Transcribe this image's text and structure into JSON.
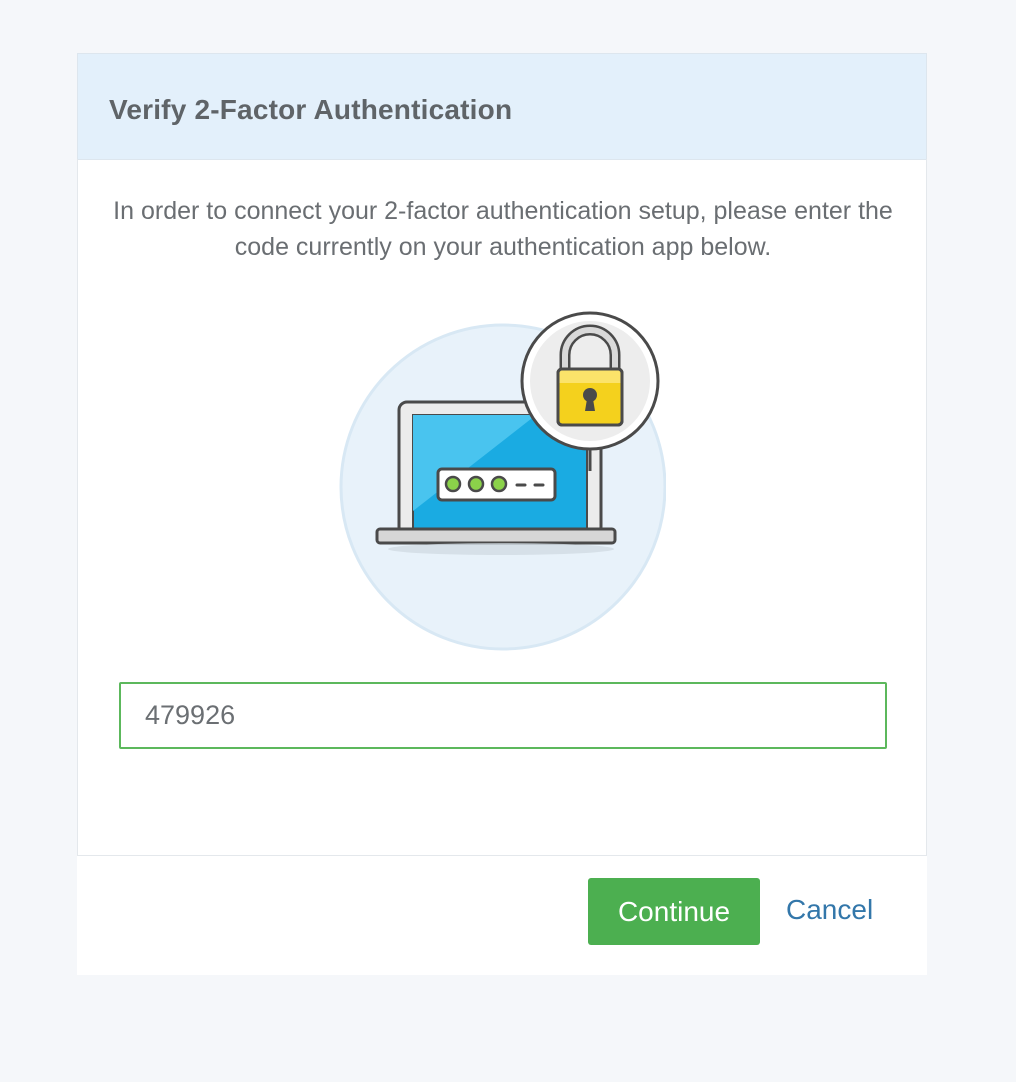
{
  "modal": {
    "title": "Verify 2-Factor Authentication",
    "intro": "In order to connect your 2-factor authentication setup, please enter the code currently on your authentication app below.",
    "illustration": {
      "icon": "laptop-lock-icon"
    },
    "code_input": {
      "value": "479926"
    },
    "buttons": {
      "continue": "Continue",
      "cancel": "Cancel"
    }
  },
  "colors": {
    "header_bg": "#e3f0fb",
    "accent_green": "#4caf50",
    "link_blue": "#3377aa",
    "page_bg": "#f5f7fa"
  }
}
